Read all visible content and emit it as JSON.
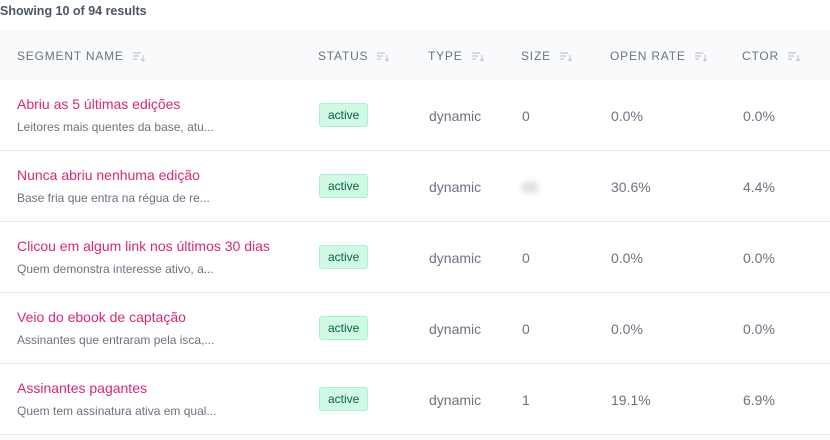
{
  "summary": "Showing 10 of 94 results",
  "columns": [
    {
      "label": "SEGMENT NAME"
    },
    {
      "label": "STATUS"
    },
    {
      "label": "TYPE"
    },
    {
      "label": "SIZE"
    },
    {
      "label": "OPEN RATE"
    },
    {
      "label": "CTOR"
    }
  ],
  "rows": [
    {
      "name": "Abriu as 5 últimas edições",
      "description": "Leitores mais quentes da base, atu...",
      "status": "active",
      "type": "dynamic",
      "size": "0",
      "open_rate": "0.0%",
      "ctor": "0.0%"
    },
    {
      "name": "Nunca abriu nenhuma edição",
      "description": "Base fria que entra na régua de re...",
      "status": "active",
      "type": "dynamic",
      "size": "00",
      "open_rate": "30.6%",
      "ctor": "4.4%"
    },
    {
      "name": "Clicou em algum link nos últimos 30 dias",
      "description": "Quem demonstra interesse ativo, a...",
      "status": "active",
      "type": "dynamic",
      "size": "0",
      "open_rate": "0.0%",
      "ctor": "0.0%"
    },
    {
      "name": "Veio do ebook de captação",
      "description": "Assinantes que entraram pela isca,...",
      "status": "active",
      "type": "dynamic",
      "size": "0",
      "open_rate": "0.0%",
      "ctor": "0.0%"
    },
    {
      "name": "Assinantes pagantes",
      "description": "Quem tem assinatura ativa em qual...",
      "status": "active",
      "type": "dynamic",
      "size": "1",
      "open_rate": "19.1%",
      "ctor": "6.9%"
    }
  ],
  "colors": {
    "accent": "#db2777",
    "badge_bg": "#d1fae5",
    "badge_text": "#065f46",
    "header_bg": "#f9fafb"
  },
  "icons": {
    "sort": "sort-icon"
  }
}
